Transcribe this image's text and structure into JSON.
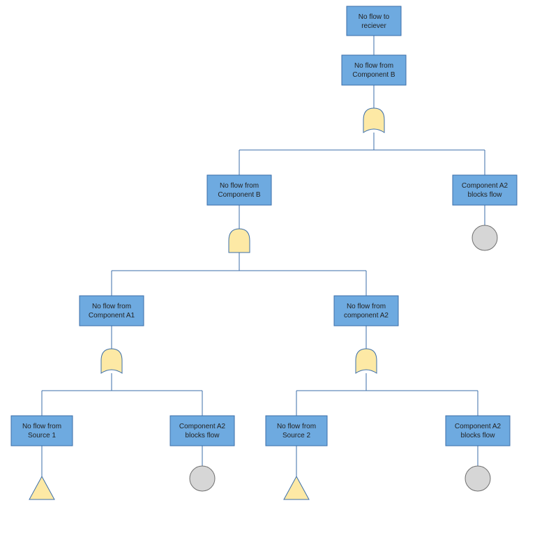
{
  "diagram": {
    "top": {
      "line1": "No flow to",
      "line2": "reciever"
    },
    "compB1": {
      "line1": "No flow from",
      "line2": "Component B"
    },
    "compB2": {
      "line1": "No flow from",
      "line2": "Component B"
    },
    "a2blocks_right": {
      "line1": "Component A2",
      "line2": "blocks flow"
    },
    "compA1": {
      "line1": "No flow from",
      "line2": "Component A1"
    },
    "compA2": {
      "line1": "No flow from",
      "line2": "component A2"
    },
    "src1": {
      "line1": "No flow from",
      "line2": "Source 1"
    },
    "a2blocks_mid": {
      "line1": "Component A2",
      "line2": "blocks flow"
    },
    "src2": {
      "line1": "No flow from",
      "line2": "Source 2"
    },
    "a2blocks_right2": {
      "line1": "Component A2",
      "line2": "blocks flow"
    }
  }
}
